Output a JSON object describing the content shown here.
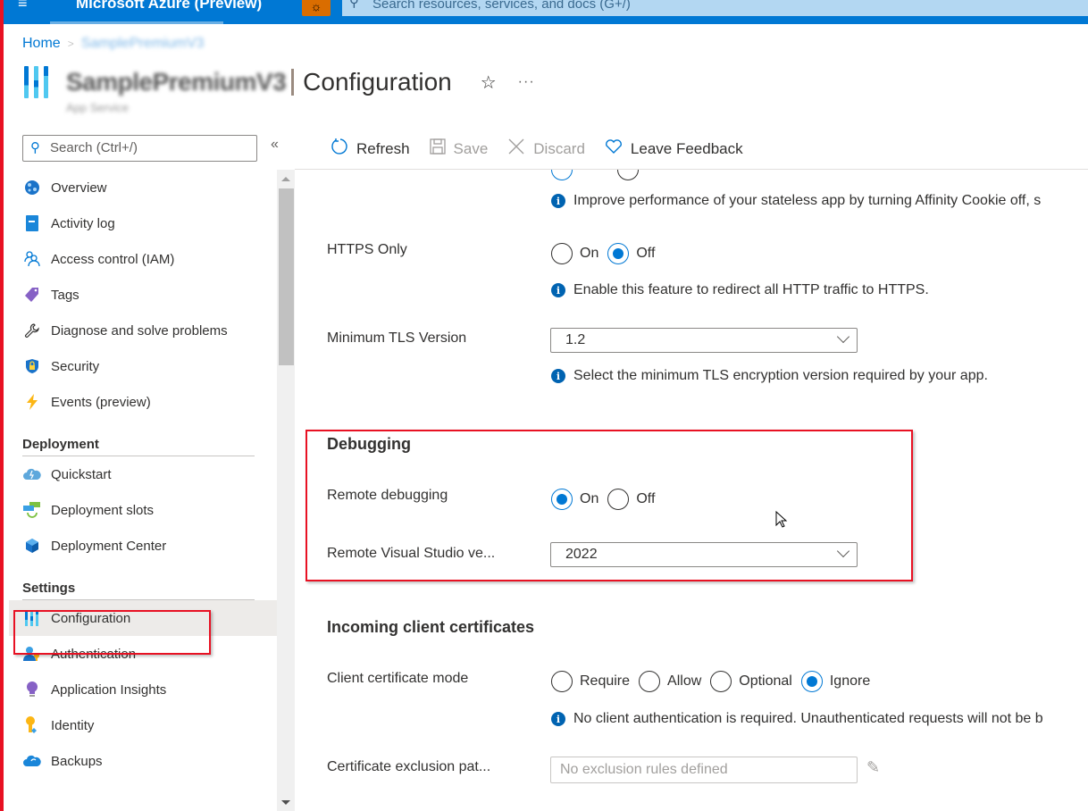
{
  "topbar": {
    "menu_icon": "hamburger-icon",
    "brand": "Microsoft Azure (Preview)",
    "bug_icon": "bug-icon",
    "search_placeholder": "Search resources, services, and docs (G+/)",
    "search_icon": "search-icon"
  },
  "breadcrumb": {
    "home": "Home",
    "separator": ">",
    "resource": "SamplePremiumV3"
  },
  "header": {
    "resource_name": "SamplePremiumV3",
    "page_title": "Configuration",
    "subtitle": "App Service",
    "favorite_icon": "☆",
    "more_icon": "···"
  },
  "sidebar": {
    "search_placeholder": "Search (Ctrl+/)",
    "collapse_icon": "«",
    "items": [
      {
        "label": "Overview",
        "icon": "globe-icon"
      },
      {
        "label": "Activity log",
        "icon": "book-icon"
      },
      {
        "label": "Access control (IAM)",
        "icon": "people-icon"
      },
      {
        "label": "Tags",
        "icon": "tag-icon"
      },
      {
        "label": "Diagnose and solve problems",
        "icon": "wrench-icon"
      },
      {
        "label": "Security",
        "icon": "shield-icon"
      },
      {
        "label": "Events (preview)",
        "icon": "lightning-icon"
      }
    ],
    "groups": [
      {
        "title": "Deployment",
        "items": [
          {
            "label": "Quickstart",
            "icon": "cloud-icon"
          },
          {
            "label": "Deployment slots",
            "icon": "slots-icon"
          },
          {
            "label": "Deployment Center",
            "icon": "cube-icon"
          }
        ]
      },
      {
        "title": "Settings",
        "items": [
          {
            "label": "Configuration",
            "icon": "configuration-icon",
            "active": true
          },
          {
            "label": "Authentication",
            "icon": "user-key-icon"
          },
          {
            "label": "Application Insights",
            "icon": "lightbulb-icon"
          },
          {
            "label": "Identity",
            "icon": "key-icon"
          },
          {
            "label": "Backups",
            "icon": "cloud-backup-icon"
          }
        ]
      }
    ]
  },
  "toolbar": {
    "refresh": "Refresh",
    "save": "Save",
    "discard": "Discard",
    "feedback": "Leave Feedback"
  },
  "content": {
    "affinity_info": "Improve performance of your stateless app by turning Affinity Cookie off, s",
    "https_only": {
      "label": "HTTPS Only",
      "options": [
        "On",
        "Off"
      ],
      "selected": "Off",
      "info": "Enable this feature to redirect all HTTP traffic to HTTPS."
    },
    "min_tls": {
      "label": "Minimum TLS Version",
      "value": "1.2",
      "info": "Select the minimum TLS encryption version required by your app."
    },
    "debugging": {
      "title": "Debugging",
      "remote_debugging": {
        "label": "Remote debugging",
        "options": [
          "On",
          "Off"
        ],
        "selected": "On"
      },
      "vs_version": {
        "label": "Remote Visual Studio ve...",
        "value": "2022"
      }
    },
    "client_certs": {
      "title": "Incoming client certificates",
      "mode": {
        "label": "Client certificate mode",
        "options": [
          "Require",
          "Allow",
          "Optional",
          "Ignore"
        ],
        "selected": "Ignore",
        "info": "No client authentication is required. Unauthenticated requests will not be b"
      },
      "exclusion": {
        "label": "Certificate exclusion pat...",
        "placeholder": "No exclusion rules defined"
      }
    }
  },
  "colors": {
    "azure_blue": "#0078d4",
    "highlight_red": "#e81123"
  }
}
